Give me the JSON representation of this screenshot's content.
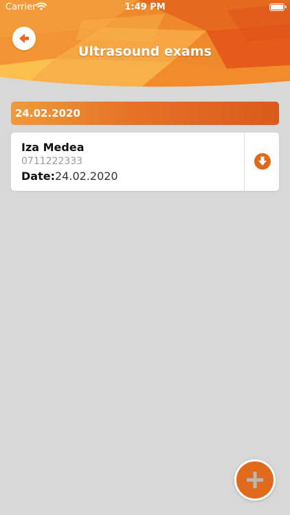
{
  "status_bar": {
    "carrier": "Carrier",
    "time": "1:49 PM",
    "wifi_icon": "wifi-icon",
    "battery_icon": "battery-icon"
  },
  "header": {
    "title": "Ultrasound exams",
    "back_icon": "arrow-left-icon"
  },
  "exams": [
    {
      "section_date": "24.02.2020",
      "items": [
        {
          "name": "Iza Medea",
          "phone": "0711222333",
          "date_label": "Date:",
          "date_value": "24.02.2020",
          "action_icon": "download-icon"
        }
      ]
    }
  ],
  "fab": {
    "icon": "plus-icon"
  },
  "colors": {
    "accent": "#df6a1c",
    "header_orange": "#f08a2a",
    "background": "#d8d8d8",
    "card": "#ffffff"
  }
}
